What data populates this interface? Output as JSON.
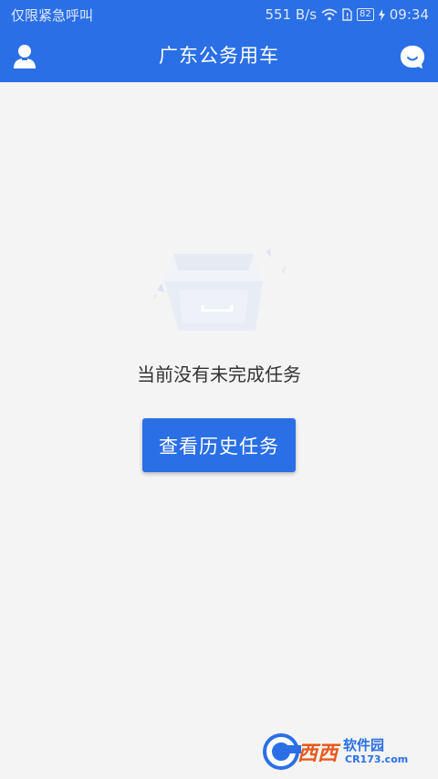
{
  "status_bar": {
    "left_text": "仅限紧急呼叫",
    "speed": "551 B/s",
    "battery": "82",
    "time": "09:34"
  },
  "header": {
    "title": "广东公务用车"
  },
  "main": {
    "empty_message": "当前没有未完成任务",
    "history_button_label": "查看历史任务"
  },
  "watermark": {
    "brand": "西西",
    "sub": "软件园",
    "url": "CR173.com"
  },
  "colors": {
    "primary": "#2a6fe6",
    "background": "#f4f4f4",
    "text": "#333333"
  },
  "icons": {
    "left": "user-icon",
    "right": "chat-icon",
    "illustration": "empty-box-icon"
  }
}
